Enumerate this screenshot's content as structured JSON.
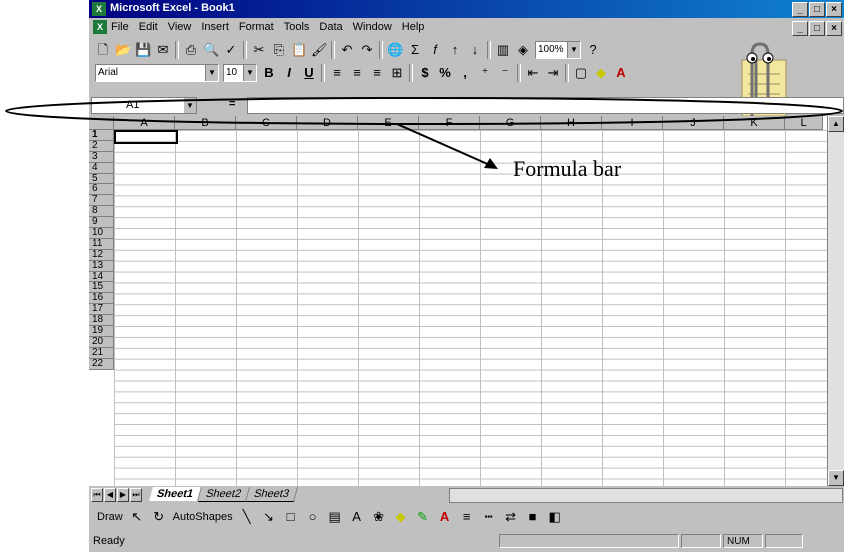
{
  "window": {
    "title": "Microsoft Excel - Book1",
    "app_icon": "X"
  },
  "window_buttons": [
    "_",
    "□",
    "×"
  ],
  "menubar": {
    "items": [
      "File",
      "Edit",
      "View",
      "Insert",
      "Format",
      "Tools",
      "Data",
      "Window",
      "Help"
    ]
  },
  "standard_toolbar": {
    "zoom": "100%"
  },
  "formatting_toolbar": {
    "font": "Arial",
    "size": "10",
    "bold": "B",
    "italic": "I",
    "underline": "U",
    "currency": "$",
    "percent": "%",
    "comma": ","
  },
  "formula_bar": {
    "name_box": "A1",
    "equals": "=",
    "value": ""
  },
  "columns": [
    "A",
    "B",
    "C",
    "D",
    "E",
    "F",
    "G",
    "H",
    "I",
    "J",
    "K",
    "L"
  ],
  "rows": [
    "1",
    "2",
    "3",
    "4",
    "5",
    "6",
    "7",
    "8",
    "9",
    "10",
    "11",
    "12",
    "13",
    "14",
    "15",
    "16",
    "17",
    "18",
    "19",
    "20",
    "21",
    "22"
  ],
  "sheet_tabs": [
    "Sheet1",
    "Sheet2",
    "Sheet3"
  ],
  "drawing_toolbar": {
    "draw": "Draw",
    "autoshapes": "AutoShapes"
  },
  "status": {
    "text": "Ready",
    "num": "NUM"
  },
  "annotation": {
    "label": "Formula bar"
  },
  "colors": {
    "title_start": "#000080",
    "title_end": "#1084d0",
    "chrome": "#c0c0c0"
  }
}
